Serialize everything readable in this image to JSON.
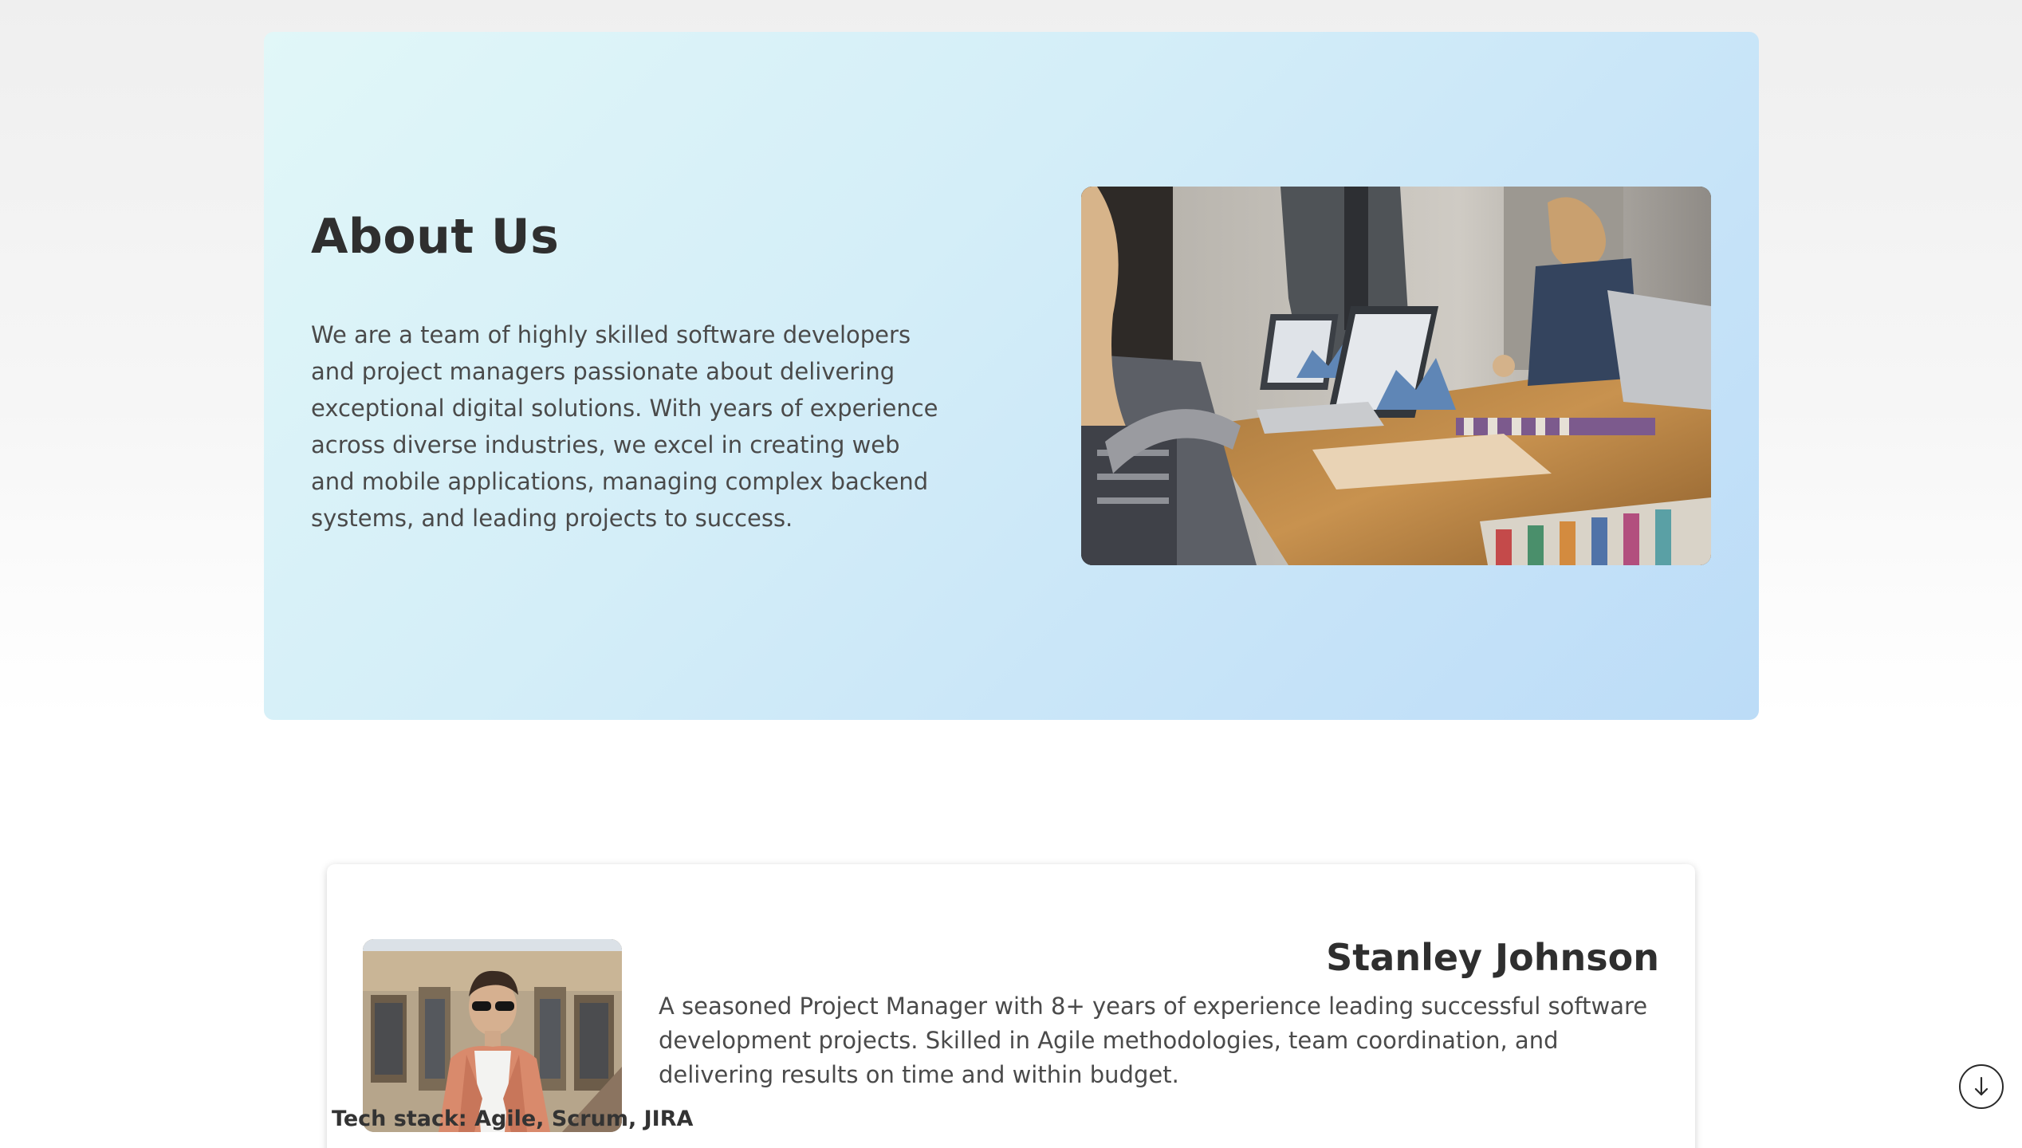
{
  "about": {
    "title": "About Us",
    "text": "We are a team of highly skilled software developers and project managers passionate about delivering exceptional digital solutions. With years of experience across diverse industries, we excel in creating web and mobile applications, managing complex backend systems, and leading projects to success.",
    "image_icon": "team-meeting-photo"
  },
  "team": {
    "members": [
      {
        "name": "Stanley Johnson",
        "bio": "A seasoned Project Manager with 8+ years of experience leading successful software development projects. Skilled in Agile methodologies, team coordination, and delivering results on time and within budget.",
        "tech_stack": "Tech stack: Agile, Scrum, JIRA",
        "avatar_icon": "person-portrait-photo"
      }
    ]
  },
  "scroll": {
    "icon": "arrow-down-icon"
  },
  "colors": {
    "hero_gradient_start": "#e1f7f8",
    "hero_gradient_end": "#bcdcf7",
    "heading": "#2f2f2f",
    "body_text": "#4a4a4a"
  }
}
